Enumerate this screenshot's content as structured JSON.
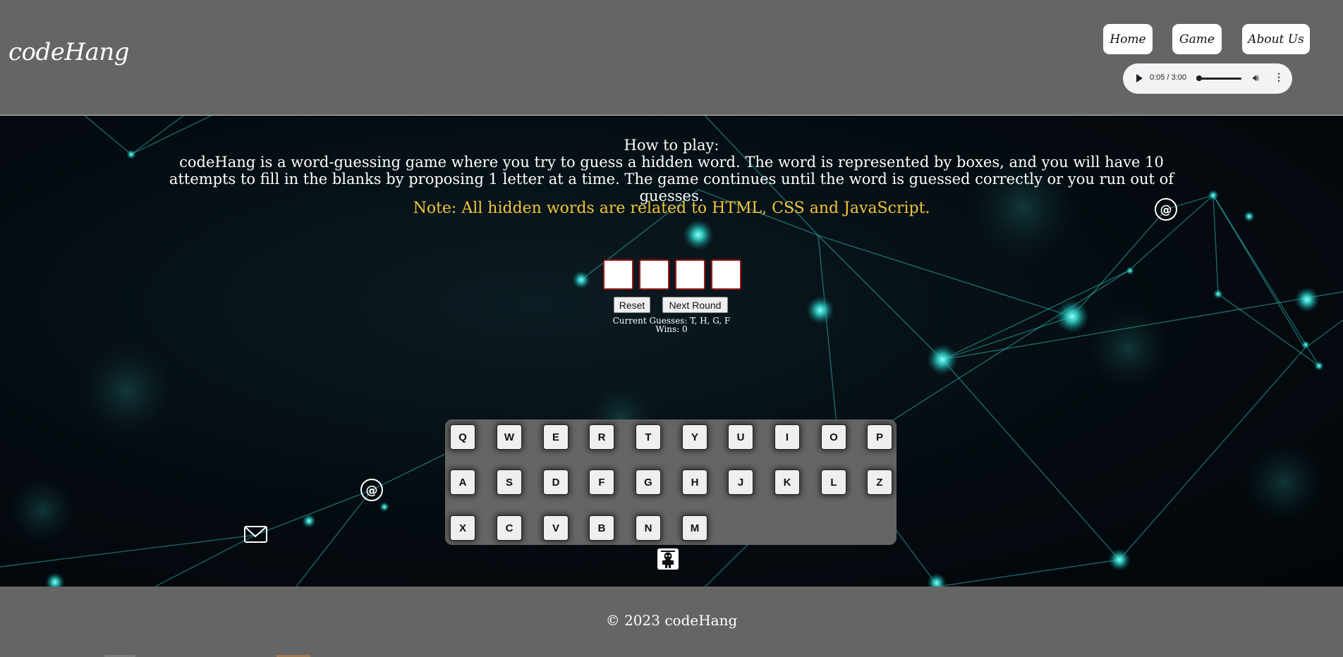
{
  "header": {
    "logo": "codeHang",
    "nav": [
      {
        "label": "Home"
      },
      {
        "label": "Game"
      },
      {
        "label": "About Us"
      }
    ],
    "audio": {
      "time": "0:05 / 3:00",
      "progress": 0.028
    }
  },
  "instructions": {
    "heading": "How to play:",
    "body": "codeHang is a word-guessing game where you try to guess a hidden word. The word is represented by boxes, and you will have 10 attempts to fill in the blanks by proposing 1 letter at a time. The game continues until the word is guessed correctly or you run out of guesses.",
    "note": "Note: All hidden words are related to HTML, CSS and JavaScript."
  },
  "game": {
    "letter_boxes": [
      "",
      "",
      "",
      ""
    ],
    "reset_label": "Reset",
    "next_round_label": "Next Round",
    "current_guesses": "Current Guesses: T, H, G, F",
    "wins": "Wins: 0"
  },
  "keyboard": {
    "rows": [
      [
        "Q",
        "W",
        "E",
        "R",
        "T",
        "Y",
        "U",
        "I",
        "O",
        "P"
      ],
      [
        "A",
        "S",
        "D",
        "F",
        "G",
        "H",
        "J",
        "K",
        "L",
        "Z"
      ],
      [
        "X",
        "C",
        "V",
        "B",
        "N",
        "M"
      ]
    ]
  },
  "footer": {
    "copyright": "© 2023 codeHang"
  },
  "colors": {
    "chrome": "#656565",
    "note": "#f2c53a",
    "box_border": "#a01818",
    "network": "#34d6d0"
  }
}
